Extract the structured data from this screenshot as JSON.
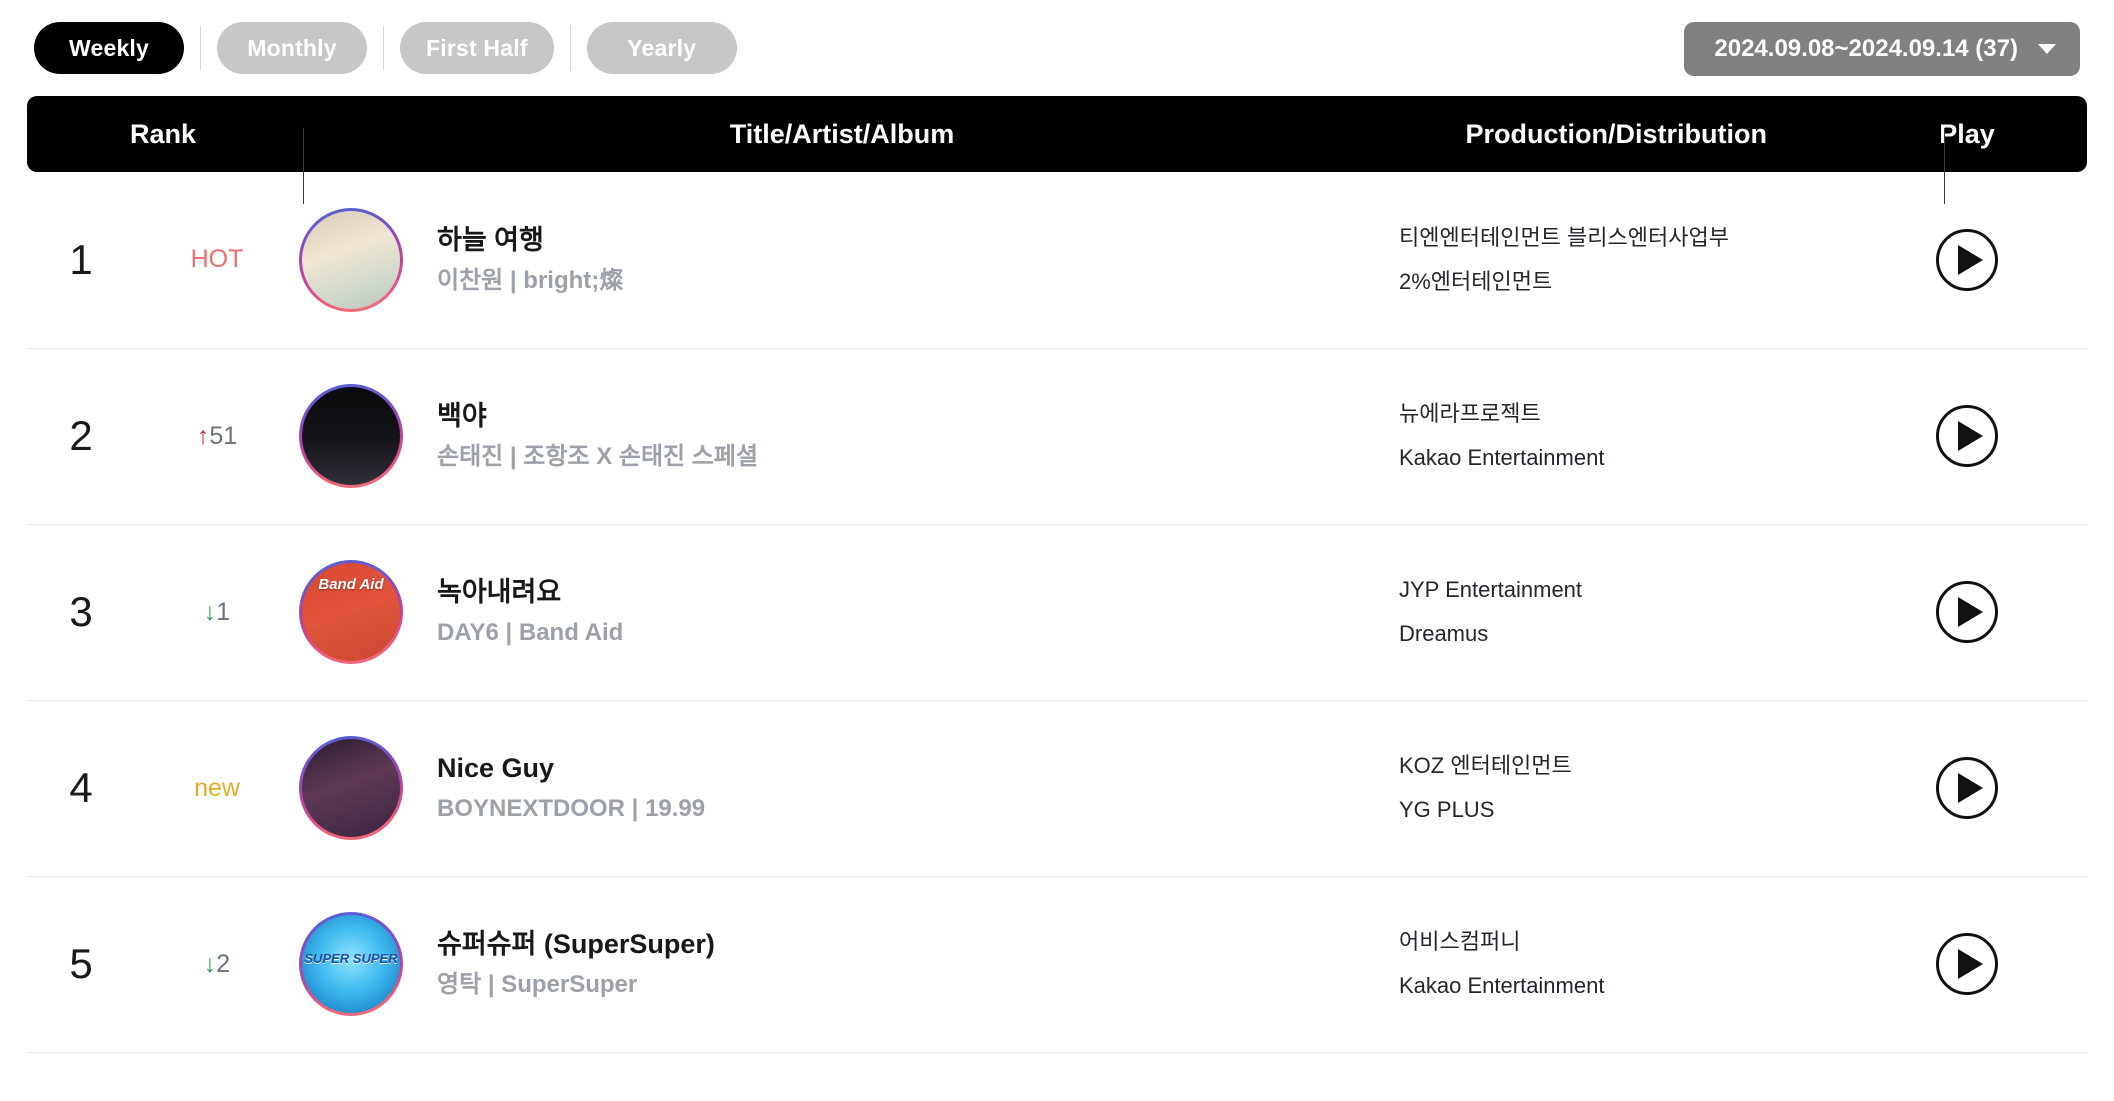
{
  "topbar": {
    "period_tabs": [
      {
        "label": "Weekly",
        "active": true
      },
      {
        "label": "Monthly",
        "active": false
      },
      {
        "label": "First Half",
        "active": false
      },
      {
        "label": "Yearly",
        "active": false
      }
    ],
    "date_selector": {
      "label": "2024.09.08~2024.09.14 (37)",
      "icon": "chevron-down-icon"
    }
  },
  "table": {
    "headers": {
      "rank": "Rank",
      "title": "Title/Artist/Album",
      "production": "Production/Distribution",
      "play": "Play"
    },
    "rows": [
      {
        "rank": "1",
        "change_type": "hot",
        "change_label": "HOT",
        "change_arrow": "",
        "change_value": "",
        "title": "하늘 여행",
        "artist": "이찬원",
        "album": "bright;燦",
        "meta": "이찬원 | bright;燦",
        "production": "티엔엔터테인먼트 블리스엔터사업부",
        "distribution": "2%엔터테인먼트",
        "play_label": "play-button"
      },
      {
        "rank": "2",
        "change_type": "up",
        "change_label": "",
        "change_arrow": "↑",
        "change_value": "51",
        "title": "백야",
        "artist": "손태진",
        "album": "조항조 X 손태진 스페셜",
        "meta": "손태진 | 조항조 X 손태진 스페셜",
        "production": "뉴에라프로젝트",
        "distribution": "Kakao Entertainment",
        "play_label": "play-button"
      },
      {
        "rank": "3",
        "change_type": "down",
        "change_label": "",
        "change_arrow": "↓",
        "change_value": "1",
        "title": "녹아내려요",
        "artist": "DAY6",
        "album": "Band Aid",
        "meta": "DAY6 | Band Aid",
        "production": "JYP Entertainment",
        "distribution": "Dreamus",
        "play_label": "play-button"
      },
      {
        "rank": "4",
        "change_type": "new",
        "change_label": "new",
        "change_arrow": "",
        "change_value": "",
        "title": "Nice Guy",
        "artist": "BOYNEXTDOOR",
        "album": "19.99",
        "meta": "BOYNEXTDOOR | 19.99",
        "production": "KOZ 엔터테인먼트",
        "distribution": "YG PLUS",
        "play_label": "play-button"
      },
      {
        "rank": "5",
        "change_type": "down",
        "change_label": "",
        "change_arrow": "↓",
        "change_value": "2",
        "title": "슈퍼슈퍼 (SuperSuper)",
        "artist": "영탁",
        "album": "SuperSuper",
        "meta": "영탁 | SuperSuper",
        "production": "어비스컴퍼니",
        "distribution": "Kakao Entertainment",
        "play_label": "play-button"
      }
    ]
  },
  "colors": {
    "active_tab_bg": "#000000",
    "inactive_tab_bg": "#c7c7c7",
    "date_bg": "#808080",
    "header_bg": "#000000",
    "hot": "#eb6d6d",
    "new": "#e3ad26",
    "up_arrow": "#d32f2f",
    "down_arrow": "#2e9e55",
    "meta_text": "#9ca0a8"
  },
  "art_labels": {
    "row3": "Band Aid",
    "row5": "SUPER SUPER"
  }
}
